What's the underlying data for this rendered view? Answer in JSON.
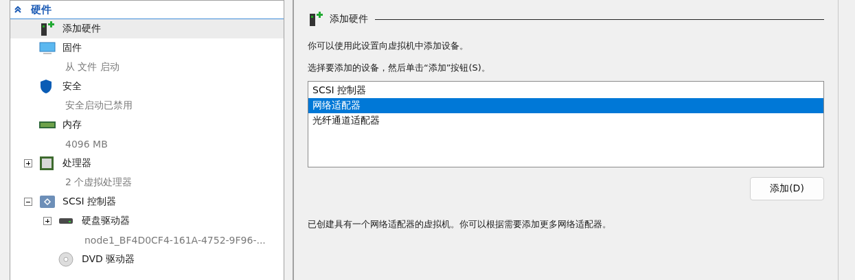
{
  "sidebar": {
    "section": {
      "title": "硬件",
      "expanded": true
    },
    "items": [
      {
        "label": "添加硬件",
        "kind": "add-hardware",
        "selected": true
      },
      {
        "label": "固件",
        "detail": "从 文件 启动",
        "kind": "monitor",
        "selected": false
      },
      {
        "label": "安全",
        "detail": "安全启动已禁用",
        "kind": "shield",
        "selected": false
      },
      {
        "label": "内存",
        "detail": "4096 MB",
        "kind": "memory",
        "selected": false
      },
      {
        "label": "处理器",
        "detail": "2 个虚拟处理器",
        "kind": "cpu",
        "expanded": false,
        "selected": false
      },
      {
        "label": "SCSI 控制器",
        "kind": "scsi",
        "expanded": true,
        "selected": false,
        "children": [
          {
            "label": "硬盘驱动器",
            "detail": "node1_BF4D0CF4-161A-4752-9F96-...",
            "kind": "disk",
            "expanded": false,
            "selected": false
          },
          {
            "label": "DVD 驱动器",
            "kind": "dvd",
            "selected": false
          }
        ]
      }
    ]
  },
  "panel": {
    "title": "添加硬件",
    "intro": "你可以使用此设置向虚拟机中添加设备。",
    "prompt": "选择要添加的设备，然后单击“添加”按钮(S)。",
    "devices": [
      {
        "label": "SCSI 控制器",
        "selected": false
      },
      {
        "label": "网络适配器",
        "selected": true
      },
      {
        "label": "光纤通道适配器",
        "selected": false
      }
    ],
    "add_button": "添加(D)",
    "note": "已创建具有一个网络适配器的虚拟机。你可以根据需要添加更多网络适配器。"
  }
}
